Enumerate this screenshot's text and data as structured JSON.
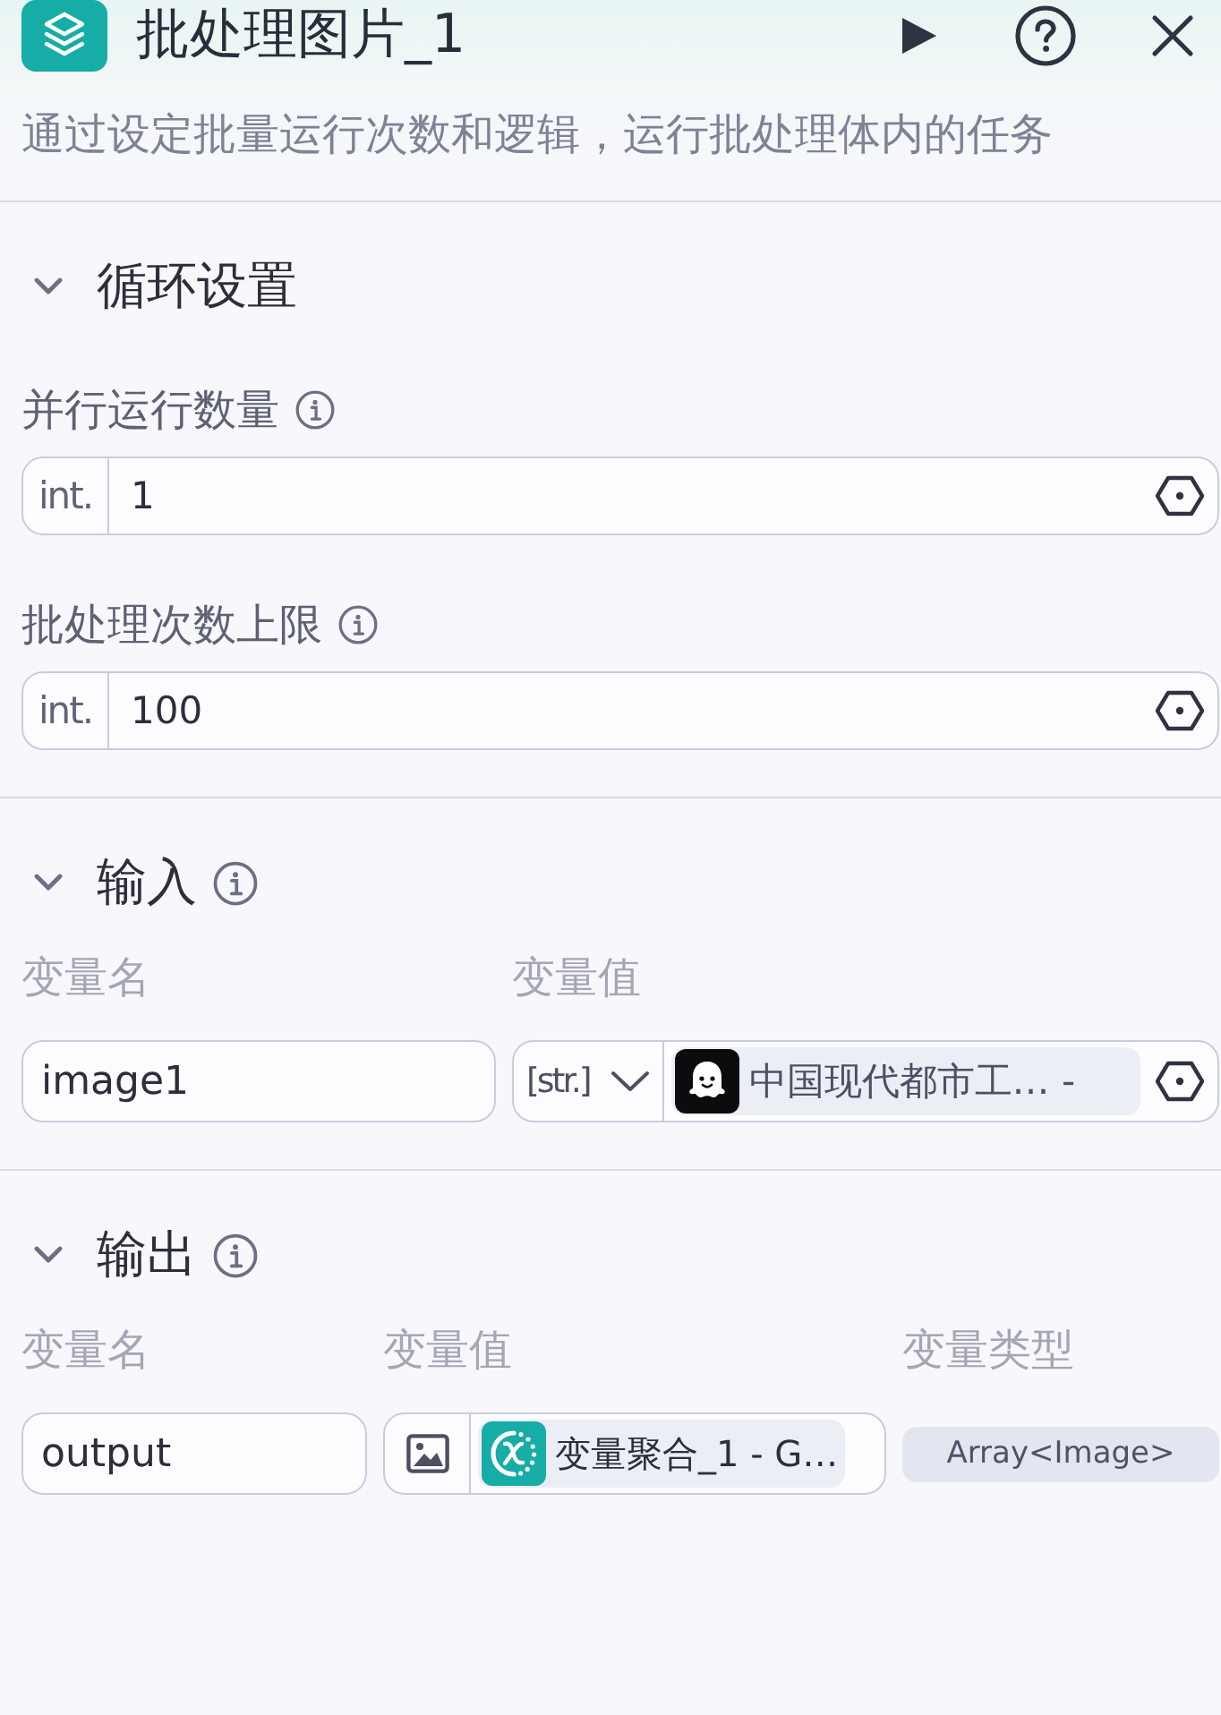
{
  "header": {
    "title": "批处理图片_1",
    "description": "通过设定批量运行次数和逻辑，运行批处理体内的任务"
  },
  "sections": [
    {
      "kind": "loop_settings",
      "title": "循环设置",
      "expanded": true,
      "fields": [
        {
          "label": "并行运行数量",
          "type_label": "int.",
          "value": "1"
        },
        {
          "label": "批处理次数上限",
          "type_label": "int.",
          "value": "100"
        }
      ]
    },
    {
      "kind": "inputs",
      "title": "输入",
      "expanded": true,
      "columns": [
        "变量名",
        "变量值"
      ],
      "rows": [
        {
          "name": "image1",
          "type_label": "[str.]",
          "reference": "中国现代都市工… -"
        }
      ]
    },
    {
      "kind": "outputs",
      "title": "输出",
      "expanded": true,
      "columns": [
        "变量名",
        "变量值",
        "变量类型"
      ],
      "rows": [
        {
          "name": "output",
          "reference": "变量聚合_1 - G…",
          "type": "Array<Image>"
        }
      ]
    }
  ]
}
